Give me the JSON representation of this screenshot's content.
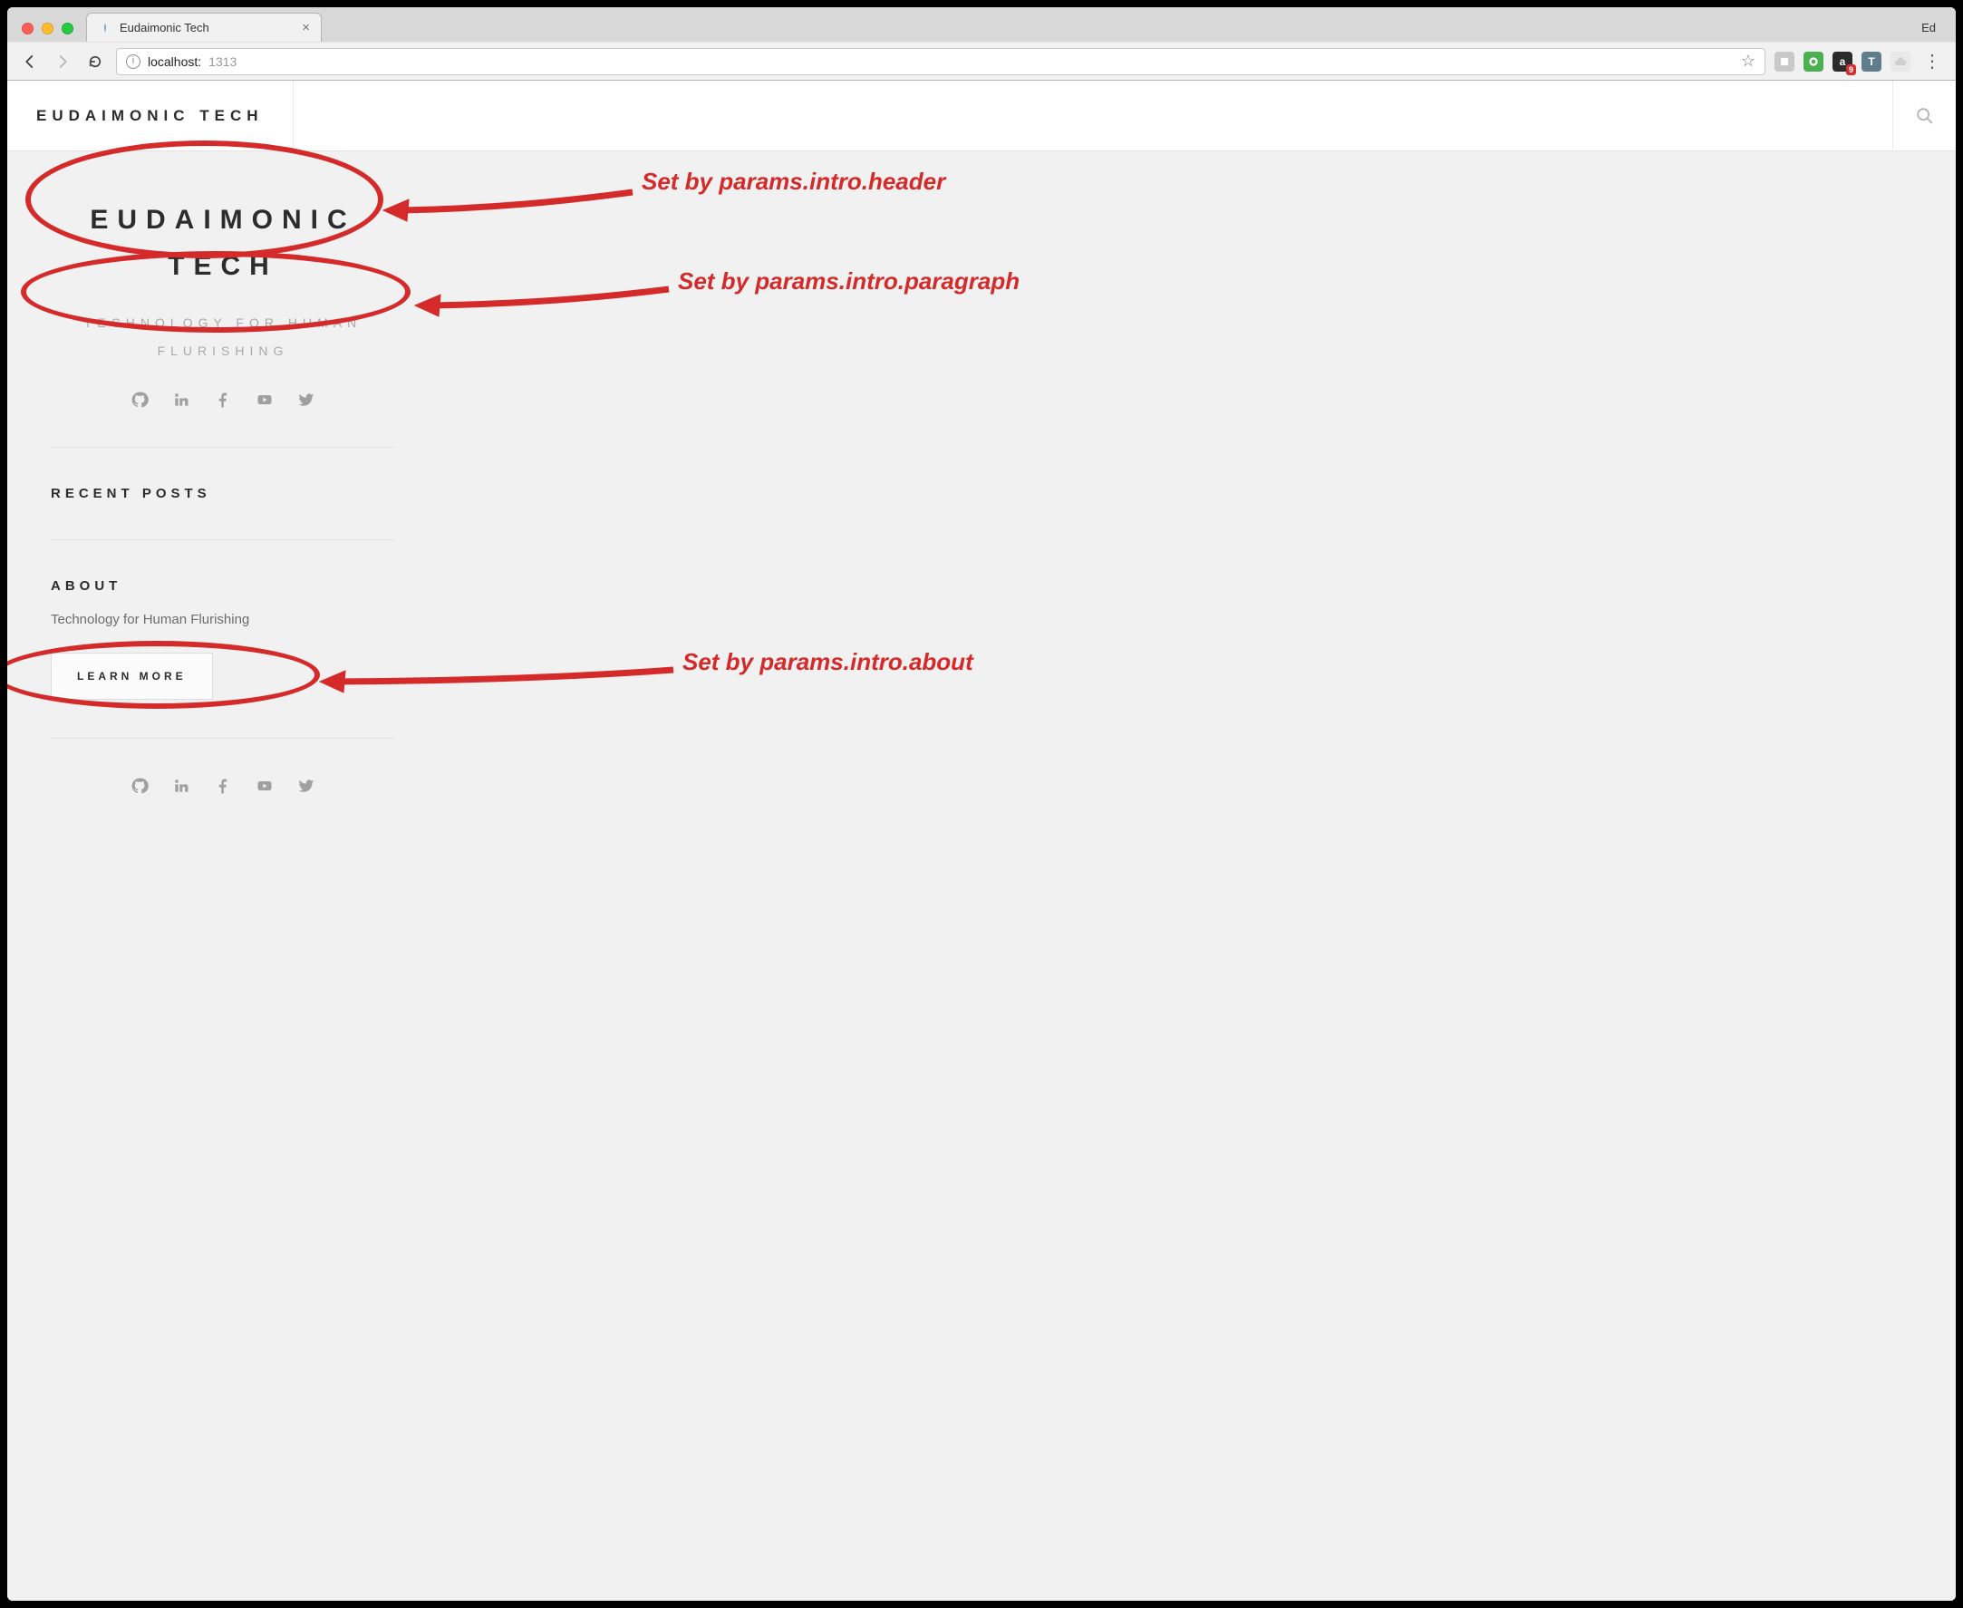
{
  "browser": {
    "profile_name": "Ed",
    "tab": {
      "title": "Eudaimonic Tech",
      "close_glyph": "×"
    },
    "url": {
      "host": "localhost:",
      "port": "1313"
    },
    "ext_badge": "9"
  },
  "header": {
    "brand": "EUDAIMONIC TECH"
  },
  "intro": {
    "header": "EUDAIMONIC\nTECH",
    "paragraph": "TECHNOLOGY FOR HUMAN\nFLURISHING"
  },
  "sections": {
    "recent_posts_title": "RECENT POSTS",
    "about_title": "ABOUT",
    "about_text": "Technology for Human Flurishing",
    "learn_more_label": "LEARN MORE"
  },
  "annotations": {
    "a1": "Set by params.intro.header",
    "a2": "Set by params.intro.paragraph",
    "a3": "Set by params.intro.about"
  }
}
